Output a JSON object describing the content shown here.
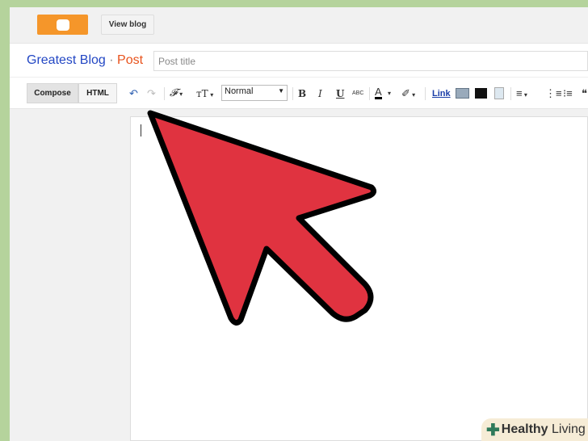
{
  "header": {
    "view_blog_label": "View blog"
  },
  "title_row": {
    "blog_name": "Greatest Blog",
    "separator": " · ",
    "section": "Post",
    "post_title_placeholder": "Post title"
  },
  "toolbar": {
    "compose_label": "Compose",
    "html_label": "HTML",
    "format_value": "Normal",
    "bold": "B",
    "italic": "I",
    "underline": "U",
    "strike": "ABC",
    "link_label": "Link",
    "font_glyph": "𝓕",
    "size_glyph": "тT"
  },
  "watermark": {
    "text_bold": "Healthy",
    "text": " Living"
  },
  "colors": {
    "accent_arrow": "#e03340",
    "blogger_orange": "#f5962a",
    "link_blue": "#2347c4"
  }
}
